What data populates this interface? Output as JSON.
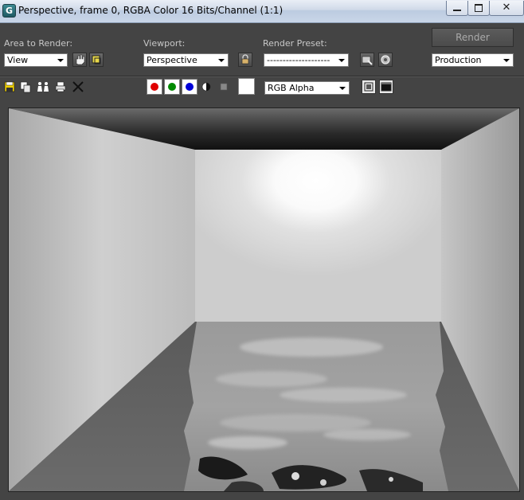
{
  "window": {
    "title": "Perspective, frame 0, RGBA Color 16 Bits/Channel (1:1)",
    "app_icon_letter": "G",
    "close_glyph": "✕"
  },
  "controls": {
    "area_label": "Area to Render:",
    "area_value": "View",
    "viewport_label": "Viewport:",
    "viewport_value": "Perspective",
    "preset_label": "Render Preset:",
    "preset_value": "--------------------",
    "render_label": "Render",
    "mode_value": "Production"
  },
  "toolbar2": {
    "channel_value": "RGB Alpha",
    "channels": [
      {
        "name": "red-channel",
        "color": "#e00000"
      },
      {
        "name": "green-channel",
        "color": "#008a00"
      },
      {
        "name": "blue-channel",
        "color": "#0000d8"
      }
    ]
  },
  "icons": {
    "save": "save-image-icon",
    "copy": "copy-image-icon",
    "clone": "clone-window-icon",
    "print": "print-image-icon",
    "clear": "clear-image-icon",
    "alpha": "display-alpha-icon",
    "mono": "monochrome-icon",
    "pan": "edit-region-icon",
    "auto_region": "auto-region-icon",
    "lock": "lock-viewport-icon",
    "setup": "render-setup-icon",
    "env": "environment-icon"
  }
}
